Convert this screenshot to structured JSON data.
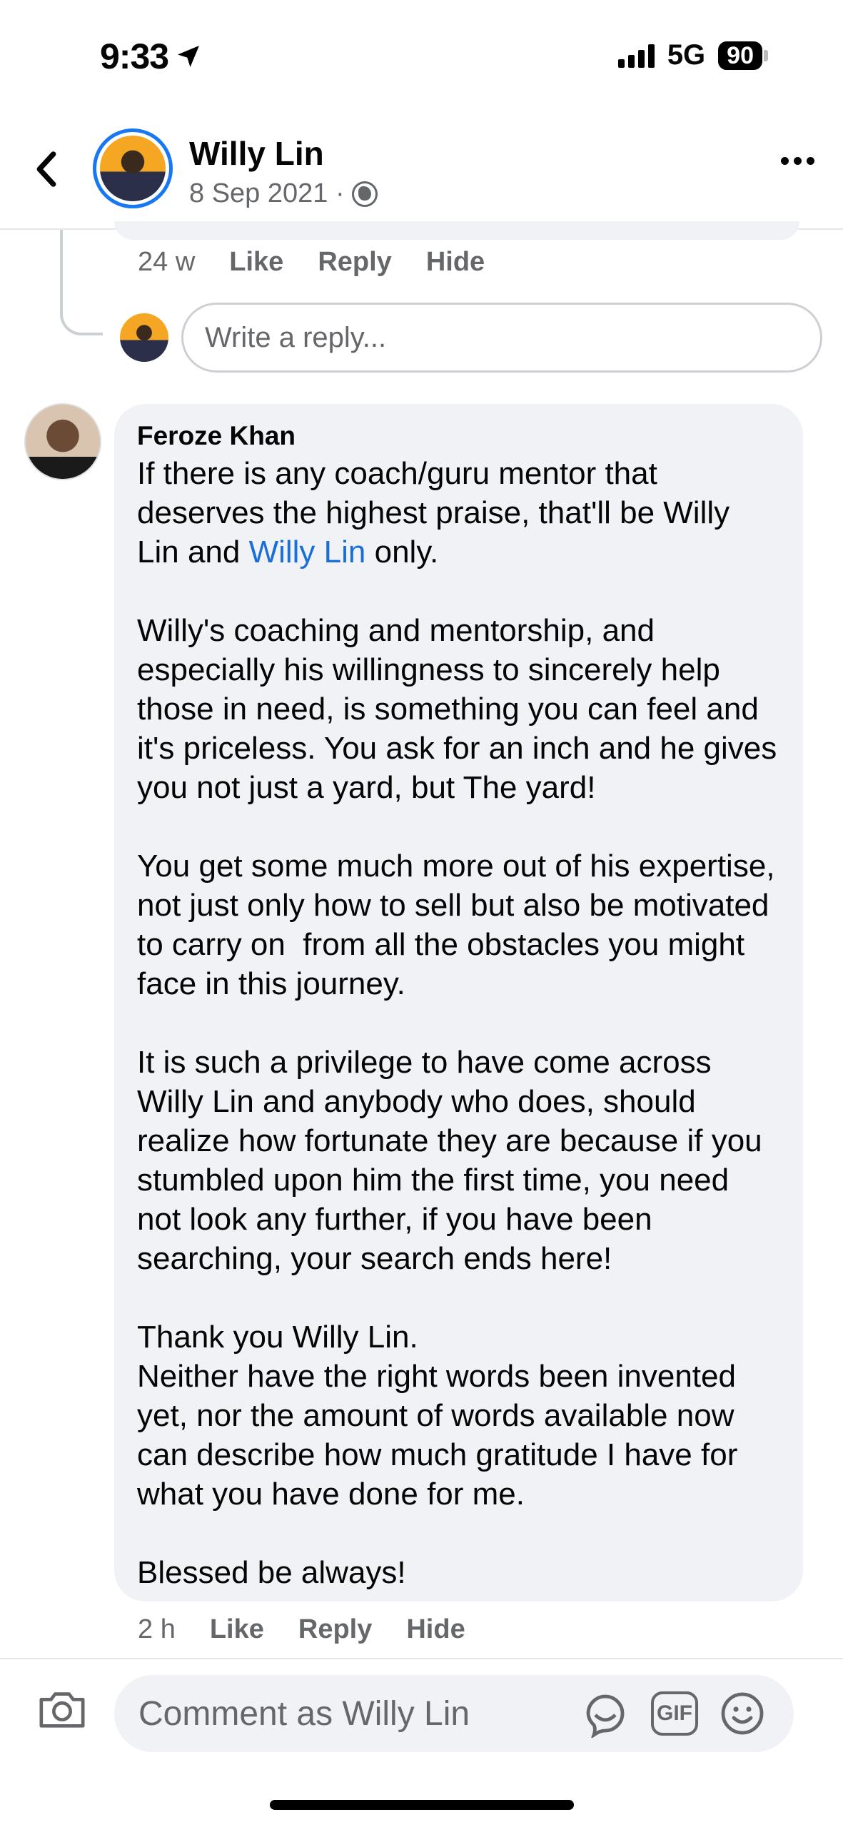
{
  "status_bar": {
    "time": "9:33",
    "network": "5G",
    "battery": "90"
  },
  "header": {
    "name": "Willy Lin",
    "date": "8 Sep 2021 ·",
    "icons": {
      "back": "chevron-left-icon",
      "privacy": "globe-icon",
      "more": "more-horizontal-icon"
    }
  },
  "previous_reply": {
    "time": "24 w",
    "like_label": "Like",
    "reply_label": "Reply",
    "hide_label": "Hide",
    "reply_placeholder": "Write a reply..."
  },
  "comment": {
    "author": "Feroze Khan",
    "text_before_mention": "If there is any coach/guru mentor that deserves the highest praise, that'll be Willy Lin and ",
    "mention": "Willy Lin",
    "text_after_mention": " only.\n\nWilly's coaching and mentorship, and especially his willingness to sincerely help those in need, is something you can feel and it's priceless. You ask for an inch and he gives you not just a yard, but The yard!\n\nYou get some much more out of his expertise, not just only how to sell but also be motivated to carry on  from all the obstacles you might face in this journey.\n\nIt is such a privilege to have come across Willy Lin and anybody who does, should realize how fortunate they are because if you stumbled upon him the first time, you need not look any further, if you have been searching, your search ends here!\n\nThank you Willy Lin.\nNeither have the right words been invented yet, nor the amount of words available now can describe how much gratitude I have for what you have done for me.\n\nBlessed be always!",
    "time": "2 h",
    "like_label": "Like",
    "reply_label": "Reply",
    "hide_label": "Hide"
  },
  "composer": {
    "placeholder": "Comment as Willy Lin",
    "gif_label": "GIF",
    "icons": {
      "camera": "camera-icon",
      "sticker": "sticker-icon",
      "emoji": "emoji-icon"
    }
  },
  "colors": {
    "accent": "#1877f2",
    "mention": "#1a6ed8",
    "bubble": "#f0f2f5",
    "secondary_text": "#65676b"
  }
}
